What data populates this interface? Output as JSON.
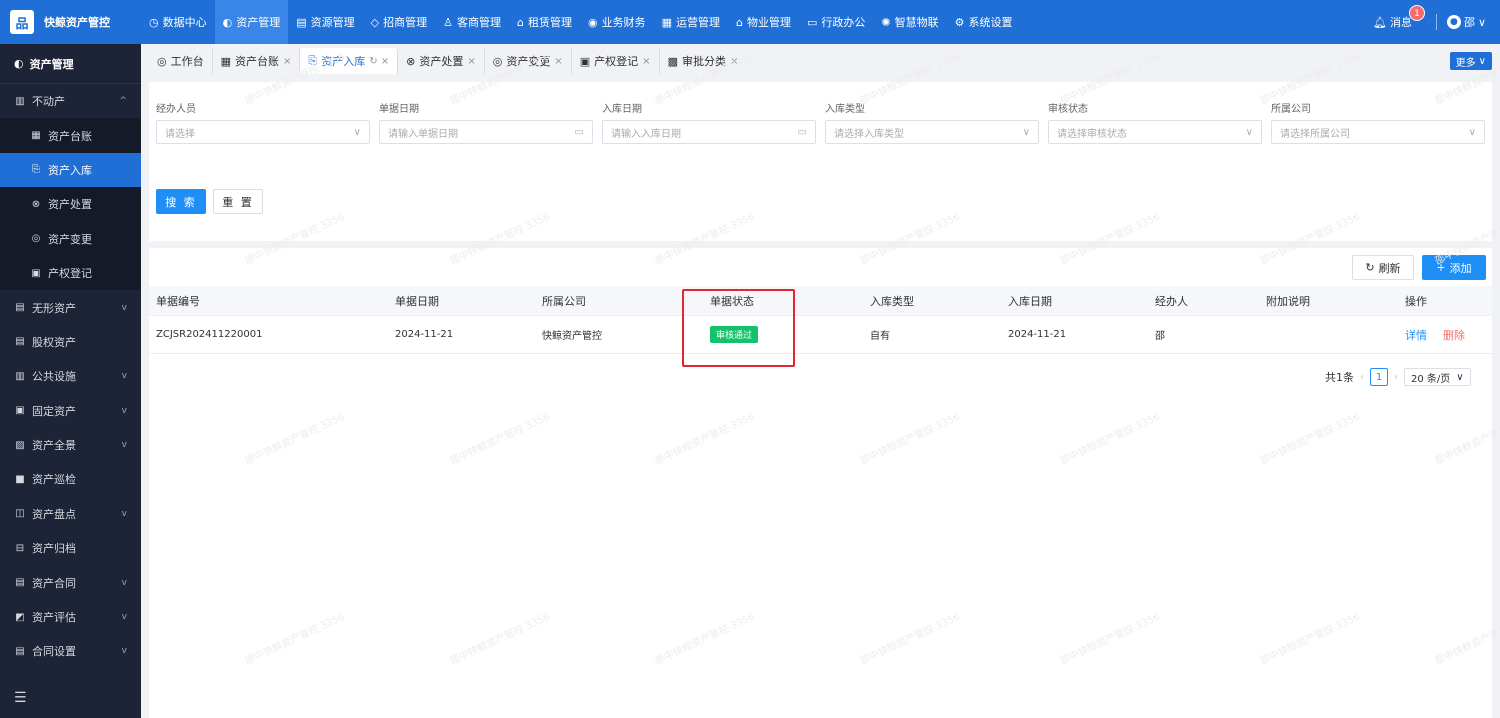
{
  "brand": {
    "logo_glyph": "品",
    "name": "快鲸资产管控"
  },
  "topnav": [
    {
      "icon": "◷",
      "label": "数据中心"
    },
    {
      "icon": "◐",
      "label": "资产管理"
    },
    {
      "icon": "▤",
      "label": "资源管理"
    },
    {
      "icon": "◇",
      "label": "招商管理"
    },
    {
      "icon": "♙",
      "label": "客商管理"
    },
    {
      "icon": "⌂",
      "label": "租赁管理"
    },
    {
      "icon": "◉",
      "label": "业务财务"
    },
    {
      "icon": "▦",
      "label": "运营管理"
    },
    {
      "icon": "⌂",
      "label": "物业管理"
    },
    {
      "icon": "▭",
      "label": "行政办公"
    },
    {
      "icon": "✺",
      "label": "智慧物联"
    },
    {
      "icon": "⚙",
      "label": "系统设置"
    }
  ],
  "top_right": {
    "message_label": "消息",
    "message_count": "1",
    "user_name": "邵"
  },
  "sidebar": {
    "header": "资产管理",
    "items": [
      {
        "label": "不动产",
        "icon": "▥",
        "chev": "^"
      },
      {
        "label": "资产台账",
        "icon": "▦"
      },
      {
        "label": "资产入库",
        "icon": "⎘"
      },
      {
        "label": "资产处置",
        "icon": "⊗"
      },
      {
        "label": "资产变更",
        "icon": "◎"
      },
      {
        "label": "产权登记",
        "icon": "▣"
      },
      {
        "label": "无形资产",
        "icon": "▤",
        "chev": "v"
      },
      {
        "label": "股权资产",
        "icon": "▤"
      },
      {
        "label": "公共设施",
        "icon": "▥",
        "chev": "v"
      },
      {
        "label": "固定资产",
        "icon": "▣",
        "chev": "v"
      },
      {
        "label": "资产全景",
        "icon": "▨",
        "chev": "v"
      },
      {
        "label": "资产巡检",
        "icon": "■"
      },
      {
        "label": "资产盘点",
        "icon": "◫",
        "chev": "v"
      },
      {
        "label": "资产归档",
        "icon": "⊟"
      },
      {
        "label": "资产合同",
        "icon": "▤",
        "chev": "v"
      },
      {
        "label": "资产评估",
        "icon": "◩",
        "chev": "v"
      },
      {
        "label": "合同设置",
        "icon": "▤",
        "chev": "v"
      }
    ],
    "collapse_icon": "☰"
  },
  "tabs": [
    {
      "icon": "◎",
      "label": "工作台",
      "close": ""
    },
    {
      "icon": "▦",
      "label": "资产台账",
      "close": "×"
    },
    {
      "icon": "⎘",
      "label": "资产入库",
      "close": "↻ ×"
    },
    {
      "icon": "⊗",
      "label": "资产处置",
      "close": "×"
    },
    {
      "icon": "◎",
      "label": "资产变更",
      "close": "×"
    },
    {
      "icon": "▣",
      "label": "产权登记",
      "close": "×"
    },
    {
      "icon": "▩",
      "label": "审批分类",
      "close": "×"
    }
  ],
  "more_label": "更多",
  "filters": [
    {
      "label": "经办人员",
      "placeholder": "请选择",
      "suffix": "∨"
    },
    {
      "label": "单据日期",
      "placeholder": "请输入单据日期",
      "suffix": "▭"
    },
    {
      "label": "入库日期",
      "placeholder": "请输入入库日期",
      "suffix": "▭"
    },
    {
      "label": "入库类型",
      "placeholder": "请选择入库类型",
      "suffix": "∨"
    },
    {
      "label": "审核状态",
      "placeholder": "请选择审核状态",
      "suffix": "∨"
    },
    {
      "label": "所属公司",
      "placeholder": "请选择所属公司",
      "suffix": "∨"
    }
  ],
  "buttons": {
    "search": "搜 索",
    "reset": "重 置",
    "refresh": "刷新",
    "add": "添加"
  },
  "table": {
    "headers": [
      "单据编号",
      "单据日期",
      "所属公司",
      "单据状态",
      "入库类型",
      "入库日期",
      "经办人",
      "附加说明",
      "操作"
    ],
    "rows": [
      {
        "code": "ZCJSR202411220001",
        "date": "2024-11-21",
        "company": "快鲸资产管控",
        "status": "审核通过",
        "type": "自有",
        "in_date": "2024-11-21",
        "handler": "邵",
        "note": "",
        "detail": "详情",
        "delete": "删除"
      }
    ]
  },
  "pager": {
    "total": "共1条",
    "current": "1",
    "size": "20 条/页"
  },
  "watermark": "邵中快鲸资产管控 3356",
  "colors": {
    "primary": "#1f6fd6",
    "button": "#1f8ff5",
    "success": "#13c26b",
    "danger": "#f56c6c",
    "sidebar": "#1d2437"
  }
}
